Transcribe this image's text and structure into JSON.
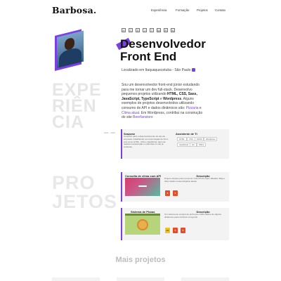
{
  "header": {
    "logo": "Barbosa.",
    "nav": [
      "Experiência",
      "Formação",
      "Projetos",
      "Contato"
    ]
  },
  "hero": {
    "tech_icons": [
      "html5-icon",
      "css3-icon",
      "sass-icon",
      "javascript-icon",
      "typescript-icon",
      "wordpress-icon",
      "react-icon",
      "node-icon"
    ],
    "title_line1": "Desenvolvedor",
    "title_line2": "Front End",
    "location": "Localizado em Itaquaquecetuba - São Paulo"
  },
  "experience": {
    "section_word": [
      "EXPE",
      "RIÊN",
      "CIA"
    ],
    "bio_start": "Sou um desenvolvedor front-end júnior estudando para me tornar um dev full-stack. Desenvolvo pequenos projetos utilizando ",
    "bio_skills": "HTML, CSS, Sass, JavaScript, TypeScript",
    "bio_and": " e ",
    "bio_wp": "Wordpress",
    "bio_mid": ". Alguns exemplos de projetos desenvolvidos utilizando consumo de API e dados dinâmicos são: ",
    "bio_link1": "Pizzaria",
    "bio_e": " e ",
    "bio_link2": "Clima atual",
    "bio_wp_sentence": ". Em Wordpress, contribui na construção do site ",
    "bio_link3": "Beerfanstore",
    "card": {
      "date": "2021 - 2022",
      "company": "Seazone",
      "description": "Contribuí para o desenvolvimento do site da empresa, trabalhando com tecnologias de front-end como HTML, CSS e JavaScript, além de realizar manutenção e melhorias no site já existente.",
      "role": "Assistente de TI",
      "chips": [
        "HTML",
        "CSS",
        "SASS",
        "Wordpress",
        "JavaScript",
        "Git",
        "Office"
      ]
    }
  },
  "projects": {
    "section_word": [
      "PRO",
      "JETOS"
    ],
    "items": [
      {
        "name": "Consulta de clima com API",
        "desc_heading": "Descrição",
        "description": "Projeto simples para consumir uma API do Open Weather Map e obter dados meteorológicos atuais"
      },
      {
        "name": "Sistema de Pizzas",
        "desc_heading": "Descrição",
        "description": "Um sistema de compra de pizza que utiliza dados de objetos dinâmicos para construir os layouts"
      }
    ],
    "more_title": "Mais projetos"
  },
  "colors": {
    "accent": "#7b3fe4",
    "section_text": "#e6e6e6",
    "card_bg": "#f3f3f3"
  }
}
